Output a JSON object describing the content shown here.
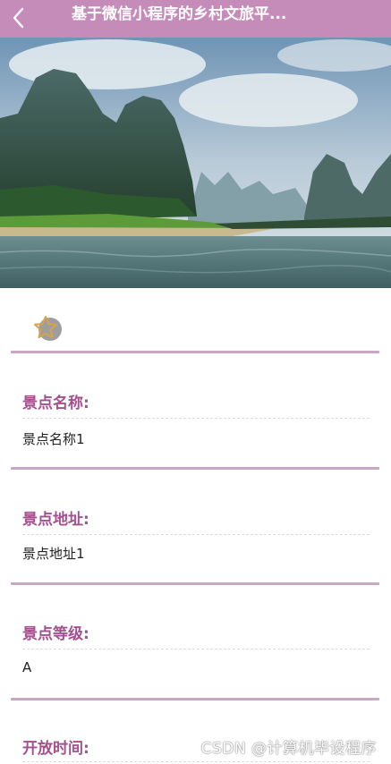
{
  "nav": {
    "title": "基于微信小程序的乡村文旅平..."
  },
  "hero": {
    "icon": "landscape-photo"
  },
  "favorite": {
    "icon": "star-icon"
  },
  "fields": [
    {
      "label": "景点名称:",
      "value": "景点名称1"
    },
    {
      "label": "景点地址:",
      "value": "景点地址1"
    },
    {
      "label": "景点等级:",
      "value": "A"
    },
    {
      "label": "开放时间:",
      "value": ""
    }
  ],
  "watermark": "CSDN @计算机毕设程序",
  "colors": {
    "nav": "#c58cba",
    "label": "#a4508f",
    "divider": "#c7a7c1"
  }
}
